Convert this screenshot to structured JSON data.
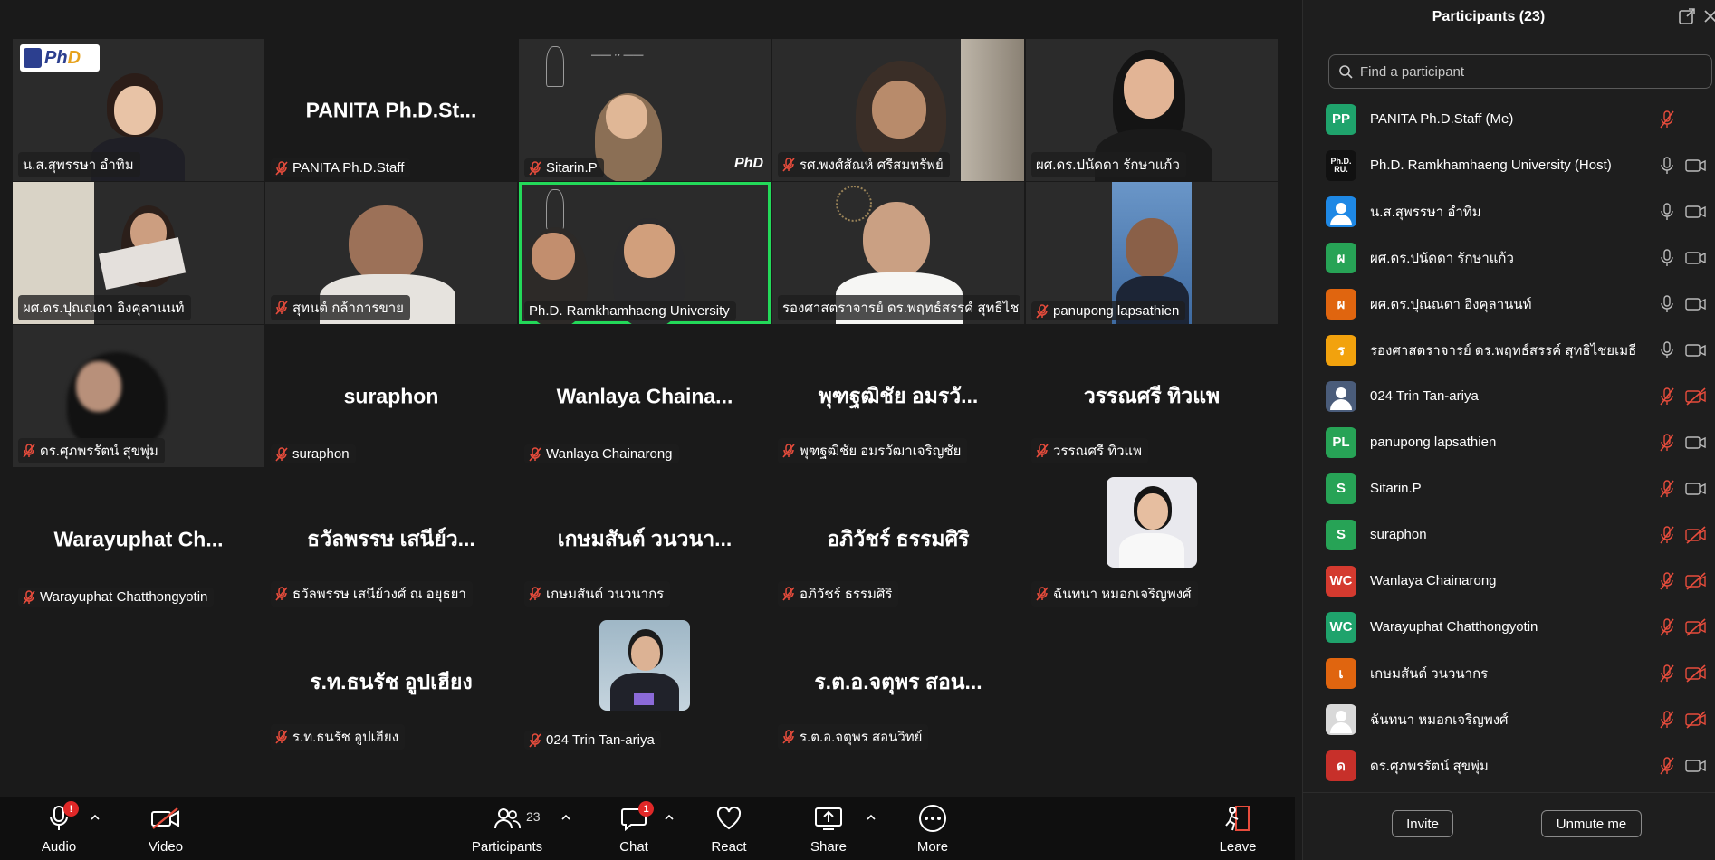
{
  "grid": {
    "tiles": [
      {
        "name_label": "น.ส.สุพรรษา อำทิม",
        "big_name": "",
        "muted": false,
        "type": "video"
      },
      {
        "name_label": "PANITA Ph.D.Staff",
        "big_name": "PANITA  Ph.D.St...",
        "muted": true,
        "type": "name"
      },
      {
        "name_label": "Sitarin.P",
        "big_name": "",
        "muted": true,
        "type": "video"
      },
      {
        "name_label": "รศ.พงศ์สัณห์ ศรีสมทรัพย์",
        "big_name": "",
        "muted": true,
        "type": "video"
      },
      {
        "name_label": "ผศ.ดร.ปนัดดา รักษาแก้ว",
        "big_name": "",
        "muted": false,
        "type": "video"
      },
      {
        "name_label": "ผศ.ดร.ปุณณดา อิงคุลานนท์",
        "big_name": "",
        "muted": false,
        "type": "video"
      },
      {
        "name_label": "สุทนต์ กล้าการขาย",
        "big_name": "",
        "muted": true,
        "type": "video"
      },
      {
        "name_label": "Ph.D. Ramkhamhaeng University",
        "big_name": "",
        "muted": false,
        "type": "video",
        "active": true
      },
      {
        "name_label": "รองศาสตราจารย์ ดร.พฤทธ์สรรค์ สุทธิไชยเมธี",
        "big_name": "",
        "muted": false,
        "type": "video"
      },
      {
        "name_label": "panupong lapsathien",
        "big_name": "",
        "muted": true,
        "type": "video"
      },
      {
        "name_label": "ดร.ศุภพรรัตน์ สุขพุ่ม",
        "big_name": "",
        "muted": true,
        "type": "video"
      },
      {
        "name_label": "suraphon",
        "big_name": "suraphon",
        "muted": true,
        "type": "name"
      },
      {
        "name_label": "Wanlaya Chainarong",
        "big_name": "Wanlaya  Chaina...",
        "muted": true,
        "type": "name"
      },
      {
        "name_label": "พุฑฐฒิชัย อมรวัฒาเจริญชัย",
        "big_name": "พุฑฐฒิชัย  อมรวั...",
        "muted": true,
        "type": "name"
      },
      {
        "name_label": "วรรณศรี  ทิวแพ",
        "big_name": "วรรณศรี  ทิวแพ",
        "muted": true,
        "type": "name"
      },
      {
        "name_label": "Warayuphat Chatthongyotin",
        "big_name": "Warayuphat  Ch...",
        "muted": true,
        "type": "name"
      },
      {
        "name_label": "ธวัลพรรษ เสนีย์วงศ์ ณ อยุธยา",
        "big_name": "ธวัลพรรษ  เสนีย์ว...",
        "muted": true,
        "type": "name"
      },
      {
        "name_label": "เกษมสันต์ วนวนากร",
        "big_name": "เกษมสันต์  วนวนา...",
        "muted": true,
        "type": "name"
      },
      {
        "name_label": "อภิวัชร์ ธรรมศิริ",
        "big_name": "อภิวัชร์  ธรรมศิริ",
        "muted": true,
        "type": "name"
      },
      {
        "name_label": "ฉันทนา หมอกเจริญพงศ์",
        "big_name": "",
        "muted": true,
        "type": "photo"
      },
      {
        "name_label": "ร.ท.ธนรัช  อูปเฮียง",
        "big_name": "ร.ท.ธนรัช  อูปเฮียง",
        "muted": true,
        "type": "name"
      },
      {
        "name_label": "024 Trin Tan-ariya",
        "big_name": "",
        "muted": true,
        "type": "photo"
      },
      {
        "name_label": "ร.ต.อ.จตุพร  สอนวิทย์",
        "big_name": "ร.ต.อ.จตุพร  สอน...",
        "muted": true,
        "type": "name"
      }
    ]
  },
  "toolbar": {
    "audio_label": "Audio",
    "audio_badge": "!",
    "video_label": "Video",
    "participants_label": "Participants",
    "participants_count": "23",
    "chat_label": "Chat",
    "chat_badge": "1",
    "react_label": "React",
    "share_label": "Share",
    "more_label": "More",
    "leave_label": "Leave"
  },
  "panel": {
    "title": "Participants (23)",
    "search_placeholder": "Find a participant",
    "participants": [
      {
        "initials": "PP",
        "name": "PANITA Ph.D.Staff (Me)",
        "color": "#1fa36c",
        "mic": "muted",
        "cam": "none"
      },
      {
        "initials": "Ph.D. RU.",
        "name": "Ph.D. Ramkhamhaeng University (Host)",
        "color": "#111111",
        "mic": "on",
        "cam": "on"
      },
      {
        "initials": "",
        "name": "น.ส.สุพรรษา อำทิม",
        "color": "#1e88e5",
        "mic": "on",
        "cam": "on"
      },
      {
        "initials": "ผ",
        "name": "ผศ.ดร.ปนัดดา รักษาแก้ว",
        "color": "#27a356",
        "mic": "on",
        "cam": "on"
      },
      {
        "initials": "ผ",
        "name": "ผศ.ดร.ปุณณดา อิงคุลานนท์",
        "color": "#e0650f",
        "mic": "on",
        "cam": "on"
      },
      {
        "initials": "ร",
        "name": "รองศาสตราจารย์ ดร.พฤทธ์สรรค์ สุทธิไชยเมธี",
        "color": "#f2a20d",
        "mic": "on",
        "cam": "on"
      },
      {
        "initials": "",
        "name": "024 Trin Tan-ariya",
        "color": "#4a5c7a",
        "mic": "muted",
        "cam": "off"
      },
      {
        "initials": "PL",
        "name": "panupong lapsathien",
        "color": "#27a356",
        "mic": "muted",
        "cam": "on"
      },
      {
        "initials": "S",
        "name": "Sitarin.P",
        "color": "#27a356",
        "mic": "muted",
        "cam": "on"
      },
      {
        "initials": "S",
        "name": "suraphon",
        "color": "#27a356",
        "mic": "muted",
        "cam": "off"
      },
      {
        "initials": "WC",
        "name": "Wanlaya Chainarong",
        "color": "#d43a2f",
        "mic": "muted",
        "cam": "off"
      },
      {
        "initials": "WC",
        "name": "Warayuphat Chatthongyotin",
        "color": "#1fa36c",
        "mic": "muted",
        "cam": "off"
      },
      {
        "initials": "เ",
        "name": "เกษมสันต์ วนวนากร",
        "color": "#e0650f",
        "mic": "muted",
        "cam": "off"
      },
      {
        "initials": "",
        "name": "ฉันทนา หมอกเจริญพงศ์",
        "color": "#d9d9d9",
        "mic": "muted",
        "cam": "off"
      },
      {
        "initials": "ด",
        "name": "ดร.ศุภพรรัตน์ สุขพุ่ม",
        "color": "#c7302a",
        "mic": "muted",
        "cam": "on"
      }
    ],
    "invite_label": "Invite",
    "unmute_label": "Unmute me"
  }
}
